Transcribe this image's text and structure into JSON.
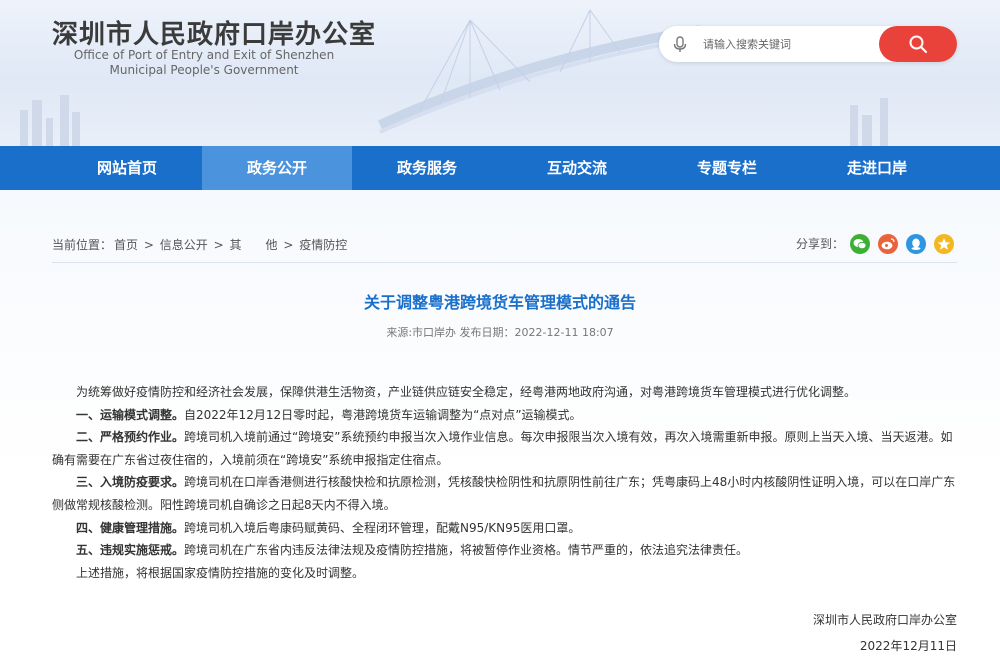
{
  "header": {
    "title_cn": "深圳市人民政府口岸办公室",
    "title_en_line1": "Office of Port of Entry and Exit of Shenzhen",
    "title_en_line2": "Municipal People's Government",
    "search_placeholder": "请输入搜索关键词"
  },
  "nav": {
    "items": [
      "网站首页",
      "政务公开",
      "政务服务",
      "互动交流",
      "专题专栏",
      "走进口岸"
    ],
    "active_index": 1
  },
  "breadcrumb": {
    "prefix": "当前位置：",
    "items": [
      "首页",
      "信息公开",
      "其　　他",
      "疫情防控"
    ],
    "separator": ">"
  },
  "share": {
    "label": "分享到：",
    "icons": [
      "wechat-icon",
      "weibo-icon",
      "qq-icon",
      "qzone-icon"
    ]
  },
  "article": {
    "title": "关于调整粤港跨境货车管理模式的通告",
    "meta": "来源:市口岸办 发布日期：2022-12-11 18:07",
    "intro": "为统筹做好疫情防控和经济社会发展，保障供港生活物资，产业链供应链安全稳定，经粤港两地政府沟通，对粤港跨境货车管理模式进行优化调整。",
    "sections": [
      {
        "heading": "一、运输模式调整。",
        "text": "自2022年12月12日零时起，粤港跨境货车运输调整为“点对点”运输模式。"
      },
      {
        "heading": "二、严格预约作业。",
        "text": "跨境司机入境前通过“跨境安”系统预约申报当次入境作业信息。每次申报限当次入境有效，再次入境需重新申报。原则上当天入境、当天返港。如确有需要在广东省过夜住宿的，入境前须在“跨境安”系统申报指定住宿点。"
      },
      {
        "heading": "三、入境防疫要求。",
        "text": "跨境司机在口岸香港侧进行核酸快检和抗原检测，凭核酸快检阴性和抗原阴性前往广东；凭粤康码上48小时内核酸阴性证明入境，可以在口岸广东侧做常规核酸检测。阳性跨境司机自确诊之日起8天内不得入境。"
      },
      {
        "heading": "四、健康管理措施。",
        "text": "跨境司机入境后粤康码赋黄码、全程闭环管理，配戴N95/KN95医用口罩。"
      },
      {
        "heading": "五、违规实施惩戒。",
        "text": "跨境司机在广东省内违反法律法规及疫情防控措施，将被暂停作业资格。情节严重的，依法追究法律责任。"
      }
    ],
    "closing": "上述措施，将根据国家疫情防控措施的变化及时调整。",
    "signature": "深圳市人民政府口岸办公室",
    "date": "2022年12月11日"
  },
  "colors": {
    "nav_bg": "#1a6fcb",
    "nav_active": "#4b93dc",
    "title_blue": "#1a6fcb",
    "search_button": "#e8423a"
  }
}
